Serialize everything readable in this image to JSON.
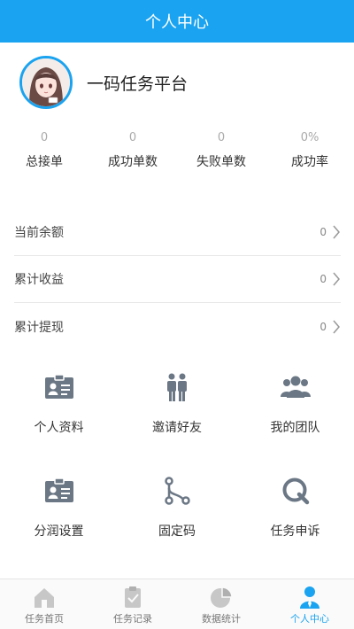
{
  "header": {
    "title": "个人中心"
  },
  "profile": {
    "name": "一码任务平台"
  },
  "stats": [
    {
      "value": "0",
      "label": "总接单"
    },
    {
      "value": "0",
      "label": "成功单数"
    },
    {
      "value": "0",
      "label": "失败单数"
    },
    {
      "value": "0%",
      "label": "成功率"
    }
  ],
  "rows": [
    {
      "label": "当前余额",
      "value": "0"
    },
    {
      "label": "累计收益",
      "value": "0"
    },
    {
      "label": "累计提现",
      "value": "0"
    }
  ],
  "grid": [
    {
      "label": "个人资料",
      "icon": "id-card-icon"
    },
    {
      "label": "邀请好友",
      "icon": "people-pair-icon"
    },
    {
      "label": "我的团队",
      "icon": "team-icon"
    },
    {
      "label": "分润设置",
      "icon": "id-card-icon"
    },
    {
      "label": "固定码",
      "icon": "branch-icon"
    },
    {
      "label": "任务申诉",
      "icon": "q-icon"
    }
  ],
  "tabbar": [
    {
      "label": "任务首页",
      "icon": "home-icon"
    },
    {
      "label": "任务记录",
      "icon": "clipboard-icon"
    },
    {
      "label": "数据统计",
      "icon": "pie-chart-icon"
    },
    {
      "label": "个人中心",
      "icon": "user-icon",
      "active": true
    }
  ],
  "colors": {
    "accent": "#1aa3f0",
    "icon_gray": "#6b7785"
  }
}
